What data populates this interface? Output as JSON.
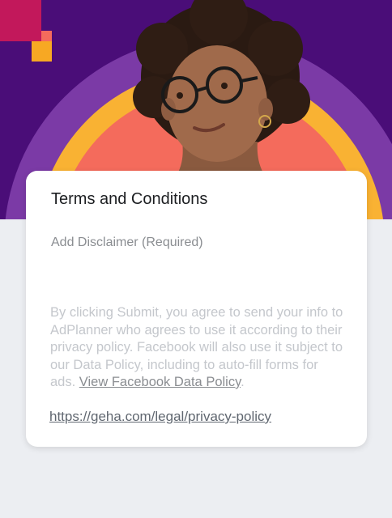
{
  "header": {
    "image": "smiling-woman-with-glasses-photo",
    "colors": {
      "background": "#4a0d78",
      "arc_outer": "#7b3aa6",
      "arc_middle": "#f9b233",
      "arc_inner": "#f46b5c",
      "square_pink": "#c2185b",
      "square_orange": "#f7a823"
    }
  },
  "card": {
    "title": "Terms and Conditions",
    "disclaimer_label": "Add Disclaimer (Required)",
    "legal_text": "By clicking Submit, you agree to send your info to AdPlanner who agrees to use it according to their privacy policy. Facebook will also use it subject to our Data Policy, including to auto-fill forms for ads. ",
    "data_policy_link": "View Facebook Data Policy",
    "legal_tail": ".",
    "privacy_policy_url": "https://geha.com/legal/privacy-policy"
  }
}
